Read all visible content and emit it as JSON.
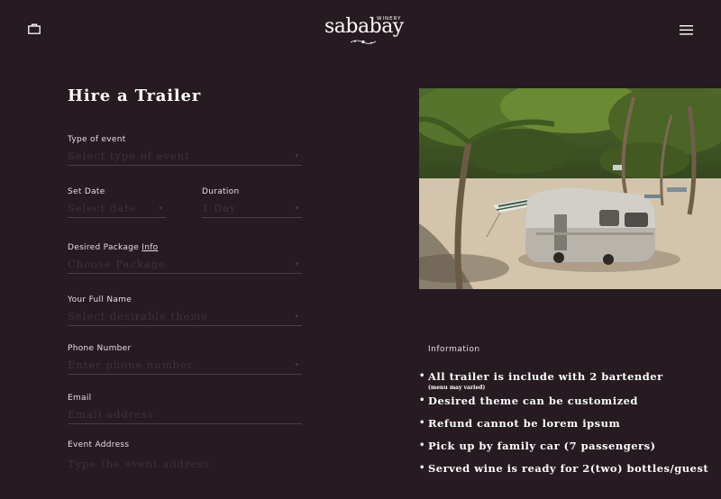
{
  "header": {
    "logo_text": "sababay",
    "logo_sub": "WINERY",
    "icons": {
      "cart": "shopping-bag-icon",
      "menu": "hamburger-menu-icon"
    }
  },
  "form": {
    "title": "Hire a Trailer",
    "event_type": {
      "label": "Type of event",
      "placeholder": "Select type of event"
    },
    "set_date": {
      "label": "Set Date",
      "placeholder": "Select date"
    },
    "duration": {
      "label": "Duration",
      "value": "1 Day"
    },
    "package": {
      "label": "Desired Package",
      "info_link": "Info",
      "placeholder": "Choose Package"
    },
    "full_name": {
      "label": "Your Full Name",
      "placeholder": "Select desirable theme"
    },
    "phone": {
      "label": "Phone Number",
      "placeholder": "Enter phone number"
    },
    "email": {
      "label": "Email",
      "placeholder": "Email address"
    },
    "address": {
      "label": "Event Address",
      "placeholder": "Type the event address"
    }
  },
  "info": {
    "label": "Information",
    "items": [
      {
        "text": "All trailer is include with 2 bartender",
        "note": "(menu may varied)"
      },
      {
        "text": "Desired theme can be customized"
      },
      {
        "text": "Refund cannot be lorem ipsum"
      },
      {
        "text": "Pick up by family car (7 passengers)"
      },
      {
        "text": "Served wine is ready for 2(two) bottles/guest"
      }
    ]
  },
  "colors": {
    "background": "#261b21",
    "text": "#ffffff",
    "placeholder": "#3e3339",
    "divider": "#4a3d44"
  }
}
